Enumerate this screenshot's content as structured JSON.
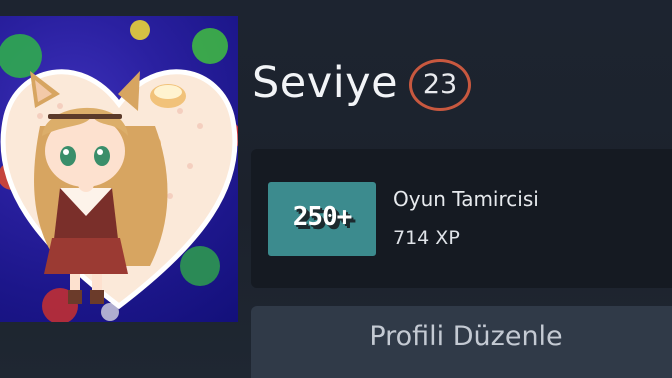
{
  "profile": {
    "avatar_alt": "profile-avatar"
  },
  "level": {
    "label": "Seviye",
    "value": "23",
    "badge_color": "#c8583f"
  },
  "featured_badge": {
    "icon_text": "250+",
    "icon_color": "#3c8b8e",
    "name": "Oyun Tamircisi",
    "xp": "714 XP"
  },
  "actions": {
    "edit_profile_label": "Profili Düzenle"
  }
}
